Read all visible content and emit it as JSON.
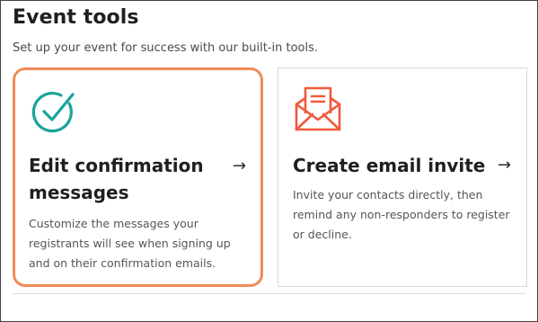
{
  "header": {
    "title": "Event tools",
    "subtitle": "Set up your event for success with our built-in tools."
  },
  "cards": [
    {
      "icon": "checkmark-circle-icon",
      "title": "Edit confirmation messages",
      "arrow": "→",
      "description": "Customize the messages your registrants will see when signing up and on their confirmation emails.",
      "accent_color": "#1aa39a",
      "selected": true,
      "border_color": "#f08c57"
    },
    {
      "icon": "open-envelope-letter-icon",
      "title": "Create email invite",
      "arrow": "→",
      "description": "Invite your contacts directly, then remind any non-responders to register or decline.",
      "accent_color": "#f05a3c",
      "selected": false
    }
  ]
}
